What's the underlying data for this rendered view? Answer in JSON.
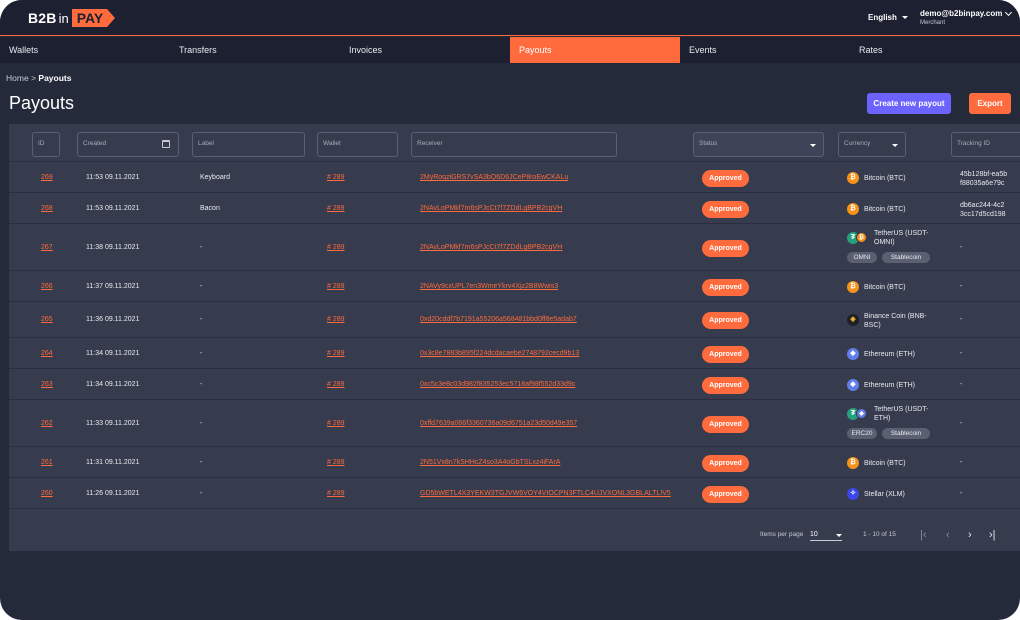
{
  "header": {
    "logo": {
      "b2b": "B2B",
      "in": "in",
      "pay": "PAY"
    },
    "language": "English",
    "user_email": "demo@b2binpay.com",
    "user_role": "Merchant"
  },
  "nav": [
    "Wallets",
    "Transfers",
    "Invoices",
    "Payouts",
    "Events",
    "Rates"
  ],
  "nav_active": "Payouts",
  "breadcrumb": {
    "home": "Home",
    "sep": ">",
    "current": "Payouts"
  },
  "page_title": "Payouts",
  "buttons": {
    "create": "Create new payout",
    "export": "Export"
  },
  "filters": {
    "id": "ID",
    "created": "Created",
    "label": "Label",
    "wallet": "Wallet",
    "receiver": "Receiver",
    "status": "Status",
    "currency": "Currency",
    "tracking": "Tracking ID"
  },
  "rows": [
    {
      "id": "269",
      "created": "11:53 09.11.2021",
      "label": "Keyboard",
      "wallet": "# 289",
      "receiver": "2MyRoqziGRS7vSA3bQ6D6JCeP8roEwCKALu",
      "status": "Approved",
      "currency": "Bitcoin (BTC)",
      "coin": "btc",
      "tracking": [
        "45b128bf-ea5b",
        "f88035a6e79c"
      ]
    },
    {
      "id": "268",
      "created": "11:53 09.11.2021",
      "label": "Bacon",
      "wallet": "# 289",
      "receiver": "2NAvLoPMkf7m6sPJcCt7f7ZDdLgBPB2cgVH",
      "status": "Approved",
      "currency": "Bitcoin (BTC)",
      "coin": "btc",
      "tracking": [
        "db6ac244-4c2",
        "3cc17d5cd198"
      ]
    },
    {
      "id": "267",
      "created": "11:38 09.11.2021",
      "label": "-",
      "wallet": "# 289",
      "receiver": "2NAvLoPMkf7m6sPJcCt7f7ZDdLgBPB2cgVH",
      "status": "Approved",
      "currency": "TetherUS (USDT-OMNI)",
      "currency_lines": [
        "TetherUS (USDT-",
        "OMNI)"
      ],
      "coin": "usdt",
      "sub": "btc",
      "tags": [
        "OMNI",
        "Stablecoin"
      ],
      "tracking": [
        "-"
      ]
    },
    {
      "id": "266",
      "created": "11:37 09.11.2021",
      "label": "-",
      "wallet": "# 289",
      "receiver": "2NAVy9cxUPL7en3WmeYkrv4Xjz2B8Wwis3",
      "status": "Approved",
      "currency": "Bitcoin (BTC)",
      "coin": "btc",
      "tracking": [
        "-"
      ]
    },
    {
      "id": "265",
      "created": "11:36 09.11.2021",
      "label": "-",
      "wallet": "# 289",
      "receiver": "0xd20cddf7b7191a55206a568481bbd0ff8e5adab7",
      "status": "Approved",
      "currency": "Binance Coin (BNB-BSC)",
      "currency_lines": [
        "Binance Coin (BNB-",
        "BSC)"
      ],
      "coin": "bnb",
      "tracking": [
        "-"
      ]
    },
    {
      "id": "264",
      "created": "11:34 09.11.2021",
      "label": "-",
      "wallet": "# 289",
      "receiver": "0x3c8e7883b895f224dcdacaebe2748792cecd9b13",
      "status": "Approved",
      "currency": "Ethereum (ETH)",
      "coin": "eth",
      "tracking": [
        "-"
      ]
    },
    {
      "id": "263",
      "created": "11:34 09.11.2021",
      "label": "-",
      "wallet": "# 289",
      "receiver": "0xc5c3e8c03d982f835253ec5718af98f552d33d9c",
      "status": "Approved",
      "currency": "Ethereum (ETH)",
      "coin": "eth",
      "tracking": [
        "-"
      ]
    },
    {
      "id": "262",
      "created": "11:33 09.11.2021",
      "label": "-",
      "wallet": "# 289",
      "receiver": "0xffd7639a066f3360736a09d6751a23d50d49e357",
      "status": "Approved",
      "currency": "TetherUS (USDT-ETH)",
      "currency_lines": [
        "TetherUS (USDT-",
        "ETH)"
      ],
      "coin": "usdt",
      "sub": "eth",
      "tags": [
        "ERC20",
        "Stablecoin"
      ],
      "tracking": [
        "-"
      ]
    },
    {
      "id": "261",
      "created": "11:31 09.11.2021",
      "label": "-",
      "wallet": "# 289",
      "receiver": "2N51Vx8n7kSHHcZ4so3A4oGbTSLxz4iFArA",
      "status": "Approved",
      "currency": "Bitcoin (BTC)",
      "coin": "btc",
      "tracking": [
        "-"
      ]
    },
    {
      "id": "260",
      "created": "11:26 09.11.2021",
      "label": "-",
      "wallet": "# 289",
      "receiver": "GD5bWETL4X3YEKW3TGJVW6VOY4VIOCPN3FTLC4UJVXONL3GBLALTLIV5",
      "status": "Approved",
      "currency": "Stellar (XLM)",
      "coin": "xlm",
      "tracking": [
        "-"
      ]
    }
  ],
  "pagination": {
    "items_per_page_label": "Items per page",
    "per_page": "10",
    "range": "1 - 10 of 15"
  },
  "colors": {
    "accent": "#ff6b3d",
    "primary": "#6c63ff",
    "background": "#252a3b",
    "panel": "#363b4d"
  }
}
